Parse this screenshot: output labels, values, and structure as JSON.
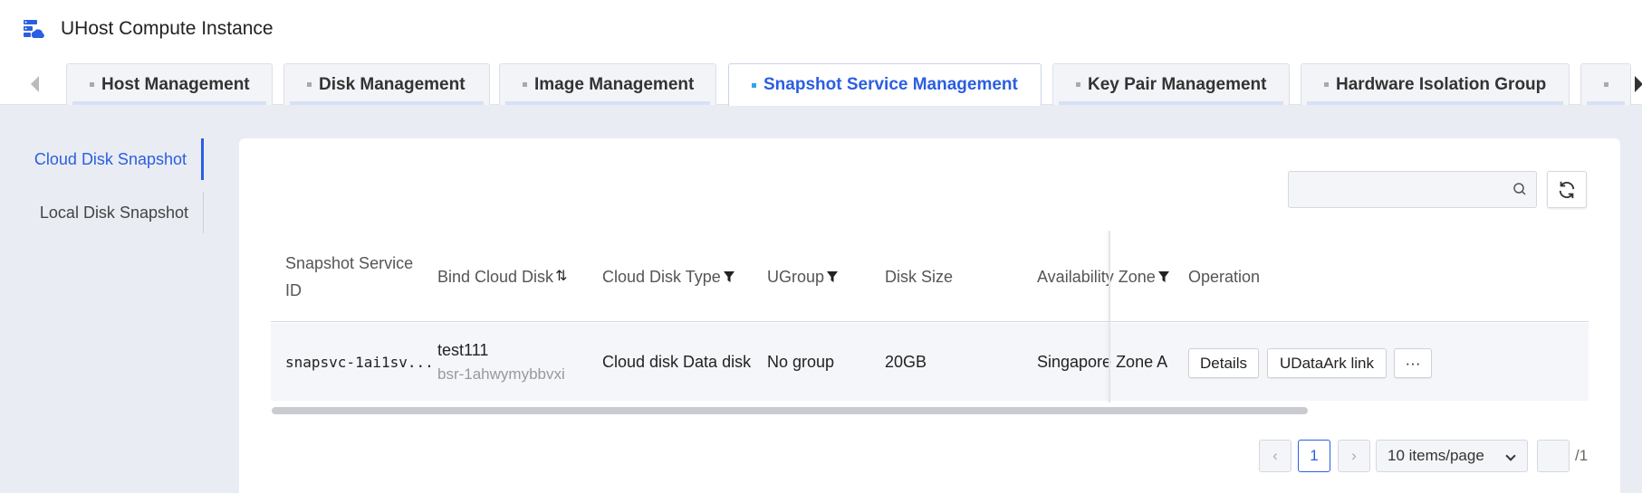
{
  "app": {
    "title": "UHost Compute Instance",
    "icon": "server-cloud-icon"
  },
  "tabs": [
    {
      "label": "Host Management",
      "active": false
    },
    {
      "label": "Disk Management",
      "active": false
    },
    {
      "label": "Image Management",
      "active": false
    },
    {
      "label": "Snapshot Service Management",
      "active": true
    },
    {
      "label": "Key Pair Management",
      "active": false
    },
    {
      "label": "Hardware Isolation Group",
      "active": false
    }
  ],
  "sidebar": {
    "items": [
      {
        "label": "Cloud Disk Snapshot",
        "active": true
      },
      {
        "label": "Local Disk Snapshot",
        "active": false
      }
    ]
  },
  "search": {
    "value": "",
    "placeholder": ""
  },
  "table": {
    "columns": {
      "snapshot_id": "Snapshot Service ID",
      "bind_disk": "Bind Cloud Disk",
      "disk_type": "Cloud Disk Type",
      "ugroup": "UGroup",
      "disk_size": "Disk Size",
      "zone": "Availability Zone",
      "operation": "Operation"
    },
    "rows": [
      {
        "snapshot_id": "snapsvc-1ai1sv...",
        "disk_name": "test111",
        "disk_id": "bsr-1ahwymybbvxi",
        "disk_type": "Cloud disk Data disk",
        "ugroup": "No group",
        "disk_size": "20GB",
        "zone": "Singapore Zone A",
        "actions": {
          "details": "Details",
          "udataark": "UDataArk link",
          "more": "···"
        }
      }
    ]
  },
  "pagination": {
    "prev": "‹",
    "current_page": "1",
    "next": "›",
    "page_size": "10 items/page",
    "jump_value": "",
    "total_pages": "/1"
  },
  "colors": {
    "accent": "#2b5ee0",
    "background": "#e9ecf3"
  }
}
